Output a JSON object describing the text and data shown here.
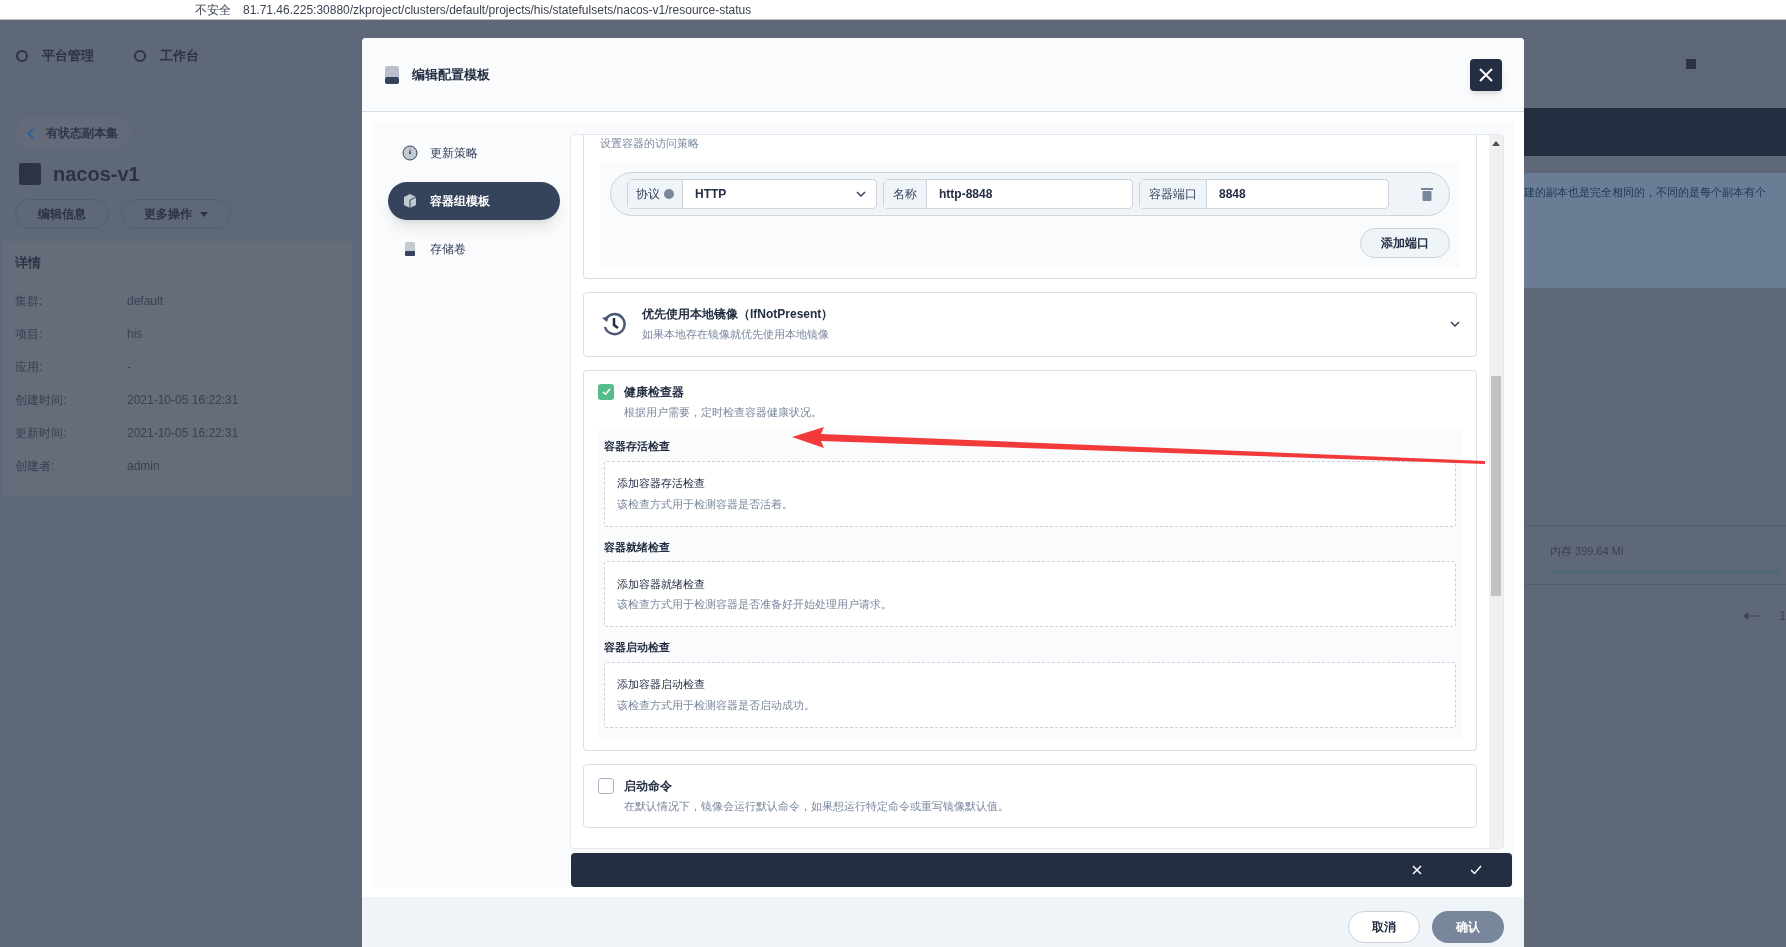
{
  "browser": {
    "security": "不安全",
    "url": "81.71.46.225:30880/zkproject/clusters/default/projects/his/statefulsets/nacos-v1/resource-status"
  },
  "background": {
    "nav": [
      {
        "label": "平台管理"
      },
      {
        "label": "工作台"
      }
    ],
    "breadcrumb": "有状态副本集",
    "title": "nacos-v1",
    "buttons": [
      "编辑信息",
      "更多操作"
    ],
    "details_title": "详情",
    "details": [
      {
        "label": "集群:",
        "value": "default"
      },
      {
        "label": "项目:",
        "value": "his"
      },
      {
        "label": "应用:",
        "value": "-"
      },
      {
        "label": "创建时间:",
        "value": "2021-10-05 16:22:31"
      },
      {
        "label": "更新时间:",
        "value": "2021-10-05 16:22:31"
      },
      {
        "label": "创建者:",
        "value": "admin"
      }
    ],
    "description": "建的副本也是完全相同的，不同的是每个副本有个",
    "memory": "内存 399.64 Mi",
    "page": "1"
  },
  "modal": {
    "title": "编辑配置模板",
    "nav": [
      {
        "label": "更新策略",
        "selected": false
      },
      {
        "label": "容器组模板",
        "selected": true
      },
      {
        "label": "存储卷",
        "selected": false
      }
    ],
    "port_hint": "设置容器的访问策略",
    "port": {
      "protocol_label": "协议",
      "protocol": "HTTP",
      "name_label": "名称",
      "name": "http-8848",
      "port_label": "容器端口",
      "port": "8848"
    },
    "add_port": "添加端口",
    "image_policy": {
      "title": "优先使用本地镜像（IfNotPresent）",
      "desc": "如果本地存在镜像就优先使用本地镜像"
    },
    "health": {
      "checked": true,
      "title": "健康检查器",
      "desc": "根据用户需要，定时检查容器健康状况。",
      "probes": [
        {
          "heading": "容器存活检查",
          "title": "添加容器存活检查",
          "desc": "该检查方式用于检测容器是否活着。"
        },
        {
          "heading": "容器就绪检查",
          "title": "添加容器就绪检查",
          "desc": "该检查方式用于检测容器是否准备好开始处理用户请求。"
        },
        {
          "heading": "容器启动检查",
          "title": "添加容器启动检查",
          "desc": "该检查方式用于检测容器是否启动成功。"
        }
      ]
    },
    "command": {
      "checked": false,
      "title": "启动命令",
      "desc": "在默认情况下，镜像会运行默认命令，如果想运行特定命令或重写镜像默认值。"
    },
    "footer_buttons": [
      "取消",
      "确认"
    ]
  }
}
